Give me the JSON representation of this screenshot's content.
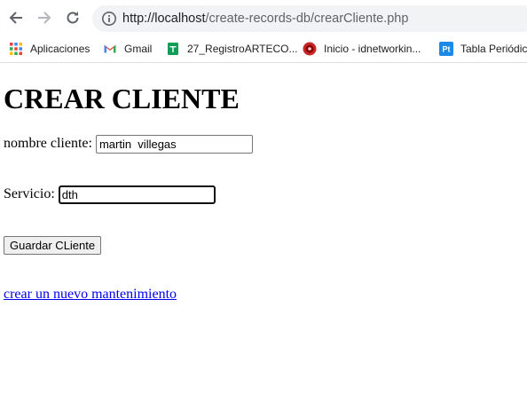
{
  "browser": {
    "url_host": "http://localhost",
    "url_path": "/create-records-db/crearCliente.php",
    "bookmarks": [
      {
        "label": "Aplicaciones",
        "icon": "apps-grid-icon"
      },
      {
        "label": "Gmail",
        "icon": "gmail-icon"
      },
      {
        "label": "27_RegistroARTECO...",
        "icon": "sheets-icon"
      },
      {
        "label": "Inicio - idnetworkin...",
        "icon": "site-favicon-icon"
      },
      {
        "label": "Tabla Periódica",
        "icon": "pt-icon"
      }
    ]
  },
  "page": {
    "title": "CREAR CLIENTE",
    "form": {
      "cliente_label": "nombre cliente:",
      "cliente_value": "martin  villegas",
      "servicio_label": "Servicio:",
      "servicio_value": "dth",
      "submit_label": "Guardar CLiente"
    },
    "link_text": "crear un nuevo mantenimiento"
  },
  "colors": {
    "link": "#0000ee",
    "omnibox_bg": "#f1f3f4",
    "icon_gray": "#5f6368"
  }
}
